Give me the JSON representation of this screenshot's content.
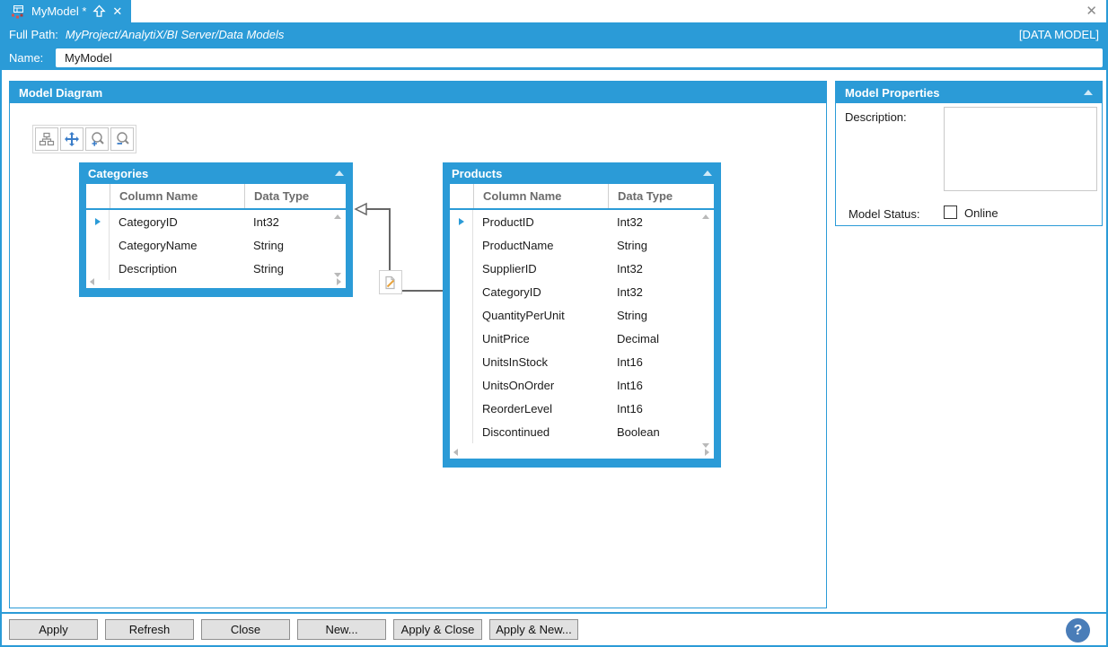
{
  "colors": {
    "primary": "#2b9bd7",
    "connector": "#666666",
    "help": "#4a7db8",
    "pencil": "#e8a33d",
    "tab_icon_red": "#d9534f"
  },
  "window": {
    "close_glyph": "✕"
  },
  "tab": {
    "title": "MyModel *",
    "close_glyph": "✕"
  },
  "header": {
    "full_path_label": "Full Path:",
    "full_path_value": "MyProject/AnalytiX/BI Server/Data Models",
    "type_badge": "[DATA MODEL]",
    "name_label": "Name:",
    "name_value": "MyModel"
  },
  "diagram": {
    "panel_title": "Model Diagram",
    "toolbar_icons": [
      "layout-icon",
      "pan-icon",
      "zoom-in-icon",
      "zoom-out-icon"
    ],
    "entities": [
      {
        "title": "Categories",
        "headers": [
          "Column Name",
          "Data Type"
        ],
        "rows": [
          [
            "CategoryID",
            "Int32"
          ],
          [
            "CategoryName",
            "String"
          ],
          [
            "Description",
            "String"
          ]
        ]
      },
      {
        "title": "Products",
        "headers": [
          "Column Name",
          "Data Type"
        ],
        "rows": [
          [
            "ProductID",
            "Int32"
          ],
          [
            "ProductName",
            "String"
          ],
          [
            "SupplierID",
            "Int32"
          ],
          [
            "CategoryID",
            "Int32"
          ],
          [
            "QuantityPerUnit",
            "String"
          ],
          [
            "UnitPrice",
            "Decimal"
          ],
          [
            "UnitsInStock",
            "Int16"
          ],
          [
            "UnitsOnOrder",
            "Int16"
          ],
          [
            "ReorderLevel",
            "Int16"
          ],
          [
            "Discontinued",
            "Boolean"
          ]
        ]
      }
    ]
  },
  "properties": {
    "panel_title": "Model Properties",
    "description_label": "Description:",
    "description_value": "",
    "model_status_label": "Model Status:",
    "online_label": "Online",
    "online_checked": false
  },
  "footer": {
    "buttons": [
      "Apply",
      "Refresh",
      "Close",
      "New...",
      "Apply & Close",
      "Apply & New..."
    ],
    "help_label": "?"
  }
}
